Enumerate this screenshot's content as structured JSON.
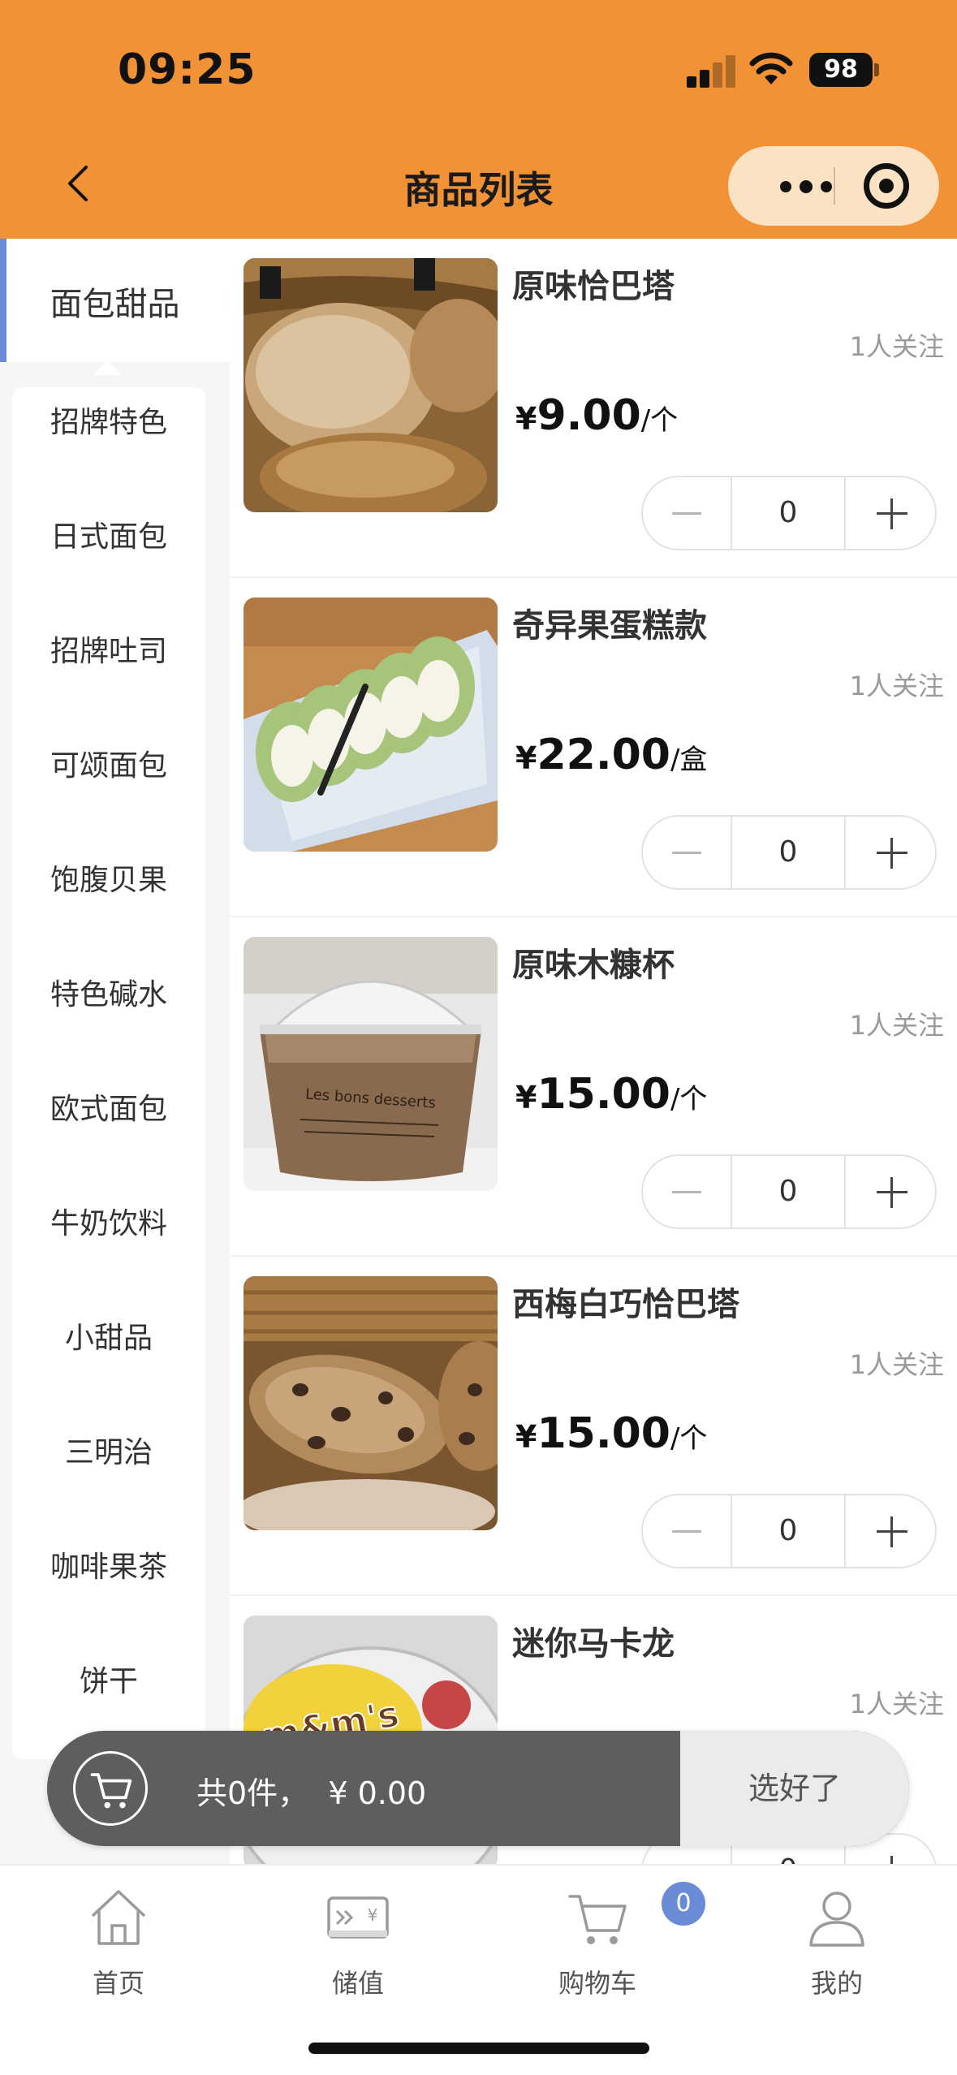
{
  "status_bar": {
    "time": "09:25",
    "battery": "98"
  },
  "header": {
    "title": "商品列表"
  },
  "colors": {
    "header_bg": "#F19237",
    "accent": "#6A8BD6",
    "capsule_bg": "#FAE2C3",
    "cart_bar": "#5E5E5C"
  },
  "sidebar": {
    "active": "面包甜品",
    "items": [
      {
        "label": "招牌特色"
      },
      {
        "label": "日式面包"
      },
      {
        "label": "招牌吐司"
      },
      {
        "label": "可颂面包"
      },
      {
        "label": "饱腹贝果"
      },
      {
        "label": "特色碱水"
      },
      {
        "label": "欧式面包"
      },
      {
        "label": "牛奶饮料"
      },
      {
        "label": "小甜品"
      },
      {
        "label": "三明治"
      },
      {
        "label": "咖啡果茶"
      },
      {
        "label": "饼干"
      }
    ]
  },
  "products": [
    {
      "name": "原味恰巴塔",
      "followers": "1人关注",
      "currency": "¥",
      "price": "9.00",
      "unit": "/个",
      "qty": "0",
      "image": "ciabatta-bread"
    },
    {
      "name": "奇异果蛋糕款",
      "followers": "1人关注",
      "currency": "¥",
      "price": "22.00",
      "unit": "/盒",
      "qty": "0",
      "image": "kiwi-roll-cake"
    },
    {
      "name": "原味木糠杯",
      "followers": "1人关注",
      "currency": "¥",
      "price": "15.00",
      "unit": "/个",
      "qty": "0",
      "image": "sawdust-cup",
      "image_text": "Les bons desserts"
    },
    {
      "name": "西梅白巧恰巴塔",
      "followers": "1人关注",
      "currency": "¥",
      "price": "15.00",
      "unit": "/个",
      "qty": "0",
      "image": "prune-ciabatta"
    },
    {
      "name": "迷你马卡龙",
      "followers": "1人关注",
      "currency": "¥",
      "price": "",
      "unit": "",
      "qty": "0",
      "image": "mini-macaron",
      "image_text": "m&m's"
    }
  ],
  "cart": {
    "summary": "共0件，  ¥ 0.00",
    "checkout_label": "选好了"
  },
  "tabbar": {
    "items": [
      {
        "label": "首页",
        "icon": "home-icon"
      },
      {
        "label": "储值",
        "icon": "stored-value-card-icon"
      },
      {
        "label": "购物车",
        "icon": "cart-icon"
      },
      {
        "label": "我的",
        "icon": "user-icon"
      }
    ],
    "cart_badge": "0"
  }
}
